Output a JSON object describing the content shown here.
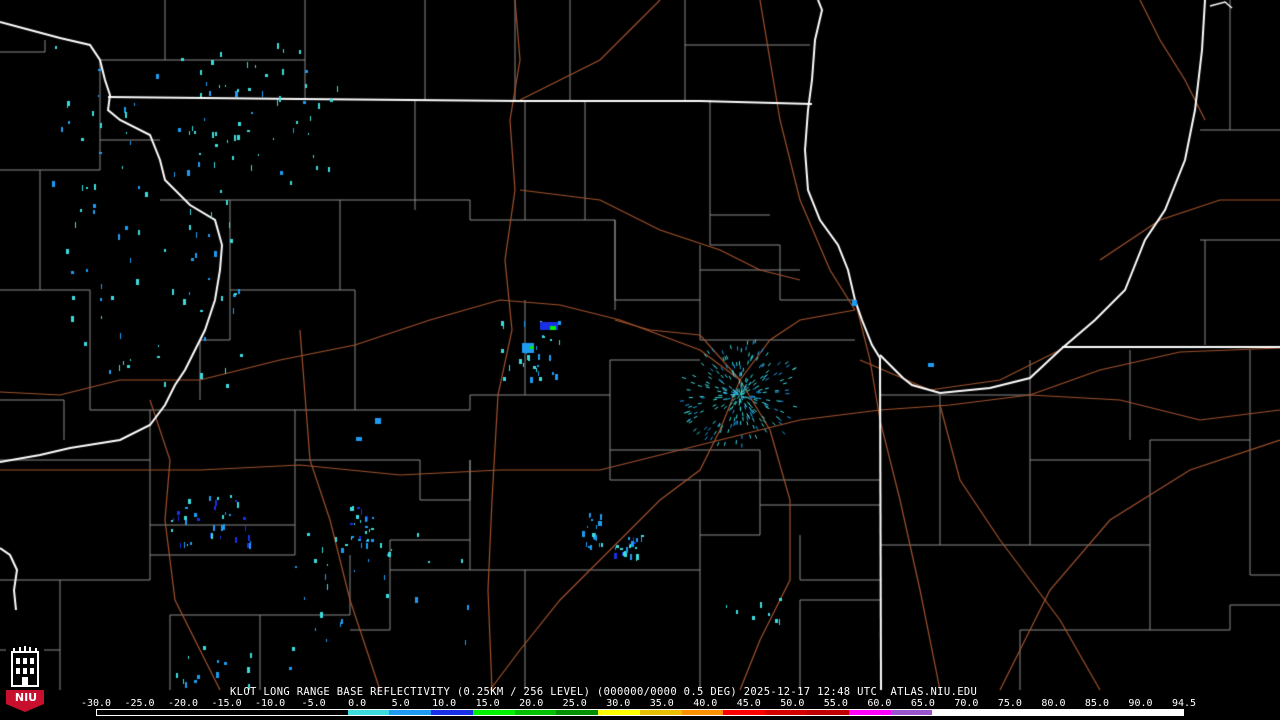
{
  "header": {
    "product_line": "KLOT LONG RANGE BASE REFLECTIVITY (0.25KM / 256 LEVEL) (000000/0000 0.5 DEG) 2025-12-17 12:48 UTC  ATLAS.NIU.EDU"
  },
  "logo": {
    "text": "NIU",
    "icon": "niu-tower-logo-icon"
  },
  "colors": {
    "background": "#000000",
    "state_border": "#ffffff",
    "county_border": "#8a8a8a",
    "highway": "#a0522d"
  },
  "color_scale": {
    "labels": [
      "-30.0",
      "-25.0",
      "-20.0",
      "-15.0",
      "-10.0",
      "-5.0",
      "0.0",
      "5.0",
      "10.0",
      "15.0",
      "20.0",
      "25.0",
      "30.0",
      "35.0",
      "40.0",
      "45.0",
      "50.0",
      "55.0",
      "60.0",
      "65.0",
      "70.0",
      "75.0",
      "80.0",
      "85.0",
      "90.0",
      "94.5"
    ],
    "colors": [
      "#000000",
      "#000000",
      "#000000",
      "#000000",
      "#000000",
      "#000000",
      "#3cdcdc",
      "#1e9bf0",
      "#1a30e6",
      "#00f000",
      "#00c000",
      "#008f00",
      "#ffff00",
      "#e6c000",
      "#ff9000",
      "#ff0000",
      "#d40000",
      "#c00000",
      "#ff00ff",
      "#9955c9",
      "#ffffff",
      "#ffffff",
      "#ffffff",
      "#ffffff",
      "#ffffff",
      "#ffffff"
    ]
  }
}
